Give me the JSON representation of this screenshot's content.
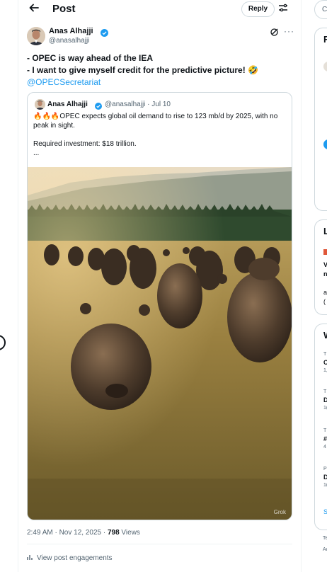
{
  "header": {
    "back_icon": "arrow-left-icon",
    "title": "Post",
    "reply_label": "Reply",
    "tune_icon": "sliders-icon"
  },
  "post": {
    "author_name": "Anas Alhajji",
    "author_handle": "@anasalhajji",
    "lines": [
      "- OPEC is way ahead of the IEA",
      "- I want to give myself credit for the predictive picture! 🤣"
    ],
    "mention": "@OPECSecretariat",
    "timestamp": "2:49 AM · Nov 12, 2025 · ",
    "views_count": "798",
    "views_label": " Views",
    "engagements_label": "View post engagements"
  },
  "quoted": {
    "author_name": "Anas Alhajji",
    "author_handle": "@anasalhajji · Jul 10",
    "line1": "🔥🔥🔥OPEC expects global oil demand to rise to 123 mb/d by 2025, with no",
    "line2": "peak in sight.",
    "line3": "Required investment: $18 trillion.",
    "line4": "...",
    "image_watermark": "Grok"
  },
  "right_sidebar": {
    "search_text": "C",
    "card1_letter": "F",
    "card2_letter": "L",
    "card2_lines": [
      "V",
      "n",
      "a",
      "("
    ],
    "card3_letter": "W",
    "trend_items": [
      {
        "small": "T",
        "bold": "C",
        "count": "1,"
      },
      {
        "small": "T",
        "bold": "D",
        "count": "1("
      },
      {
        "small": "T",
        "bold": "#",
        "count": "4"
      },
      {
        "small": "P",
        "bold": "D",
        "count": "1("
      }
    ],
    "show_more": "S",
    "footer1": "Te",
    "footer2": "Ac"
  },
  "colors": {
    "accent": "#1d9bf0",
    "muted": "#536471",
    "border": "#cfd9de"
  }
}
